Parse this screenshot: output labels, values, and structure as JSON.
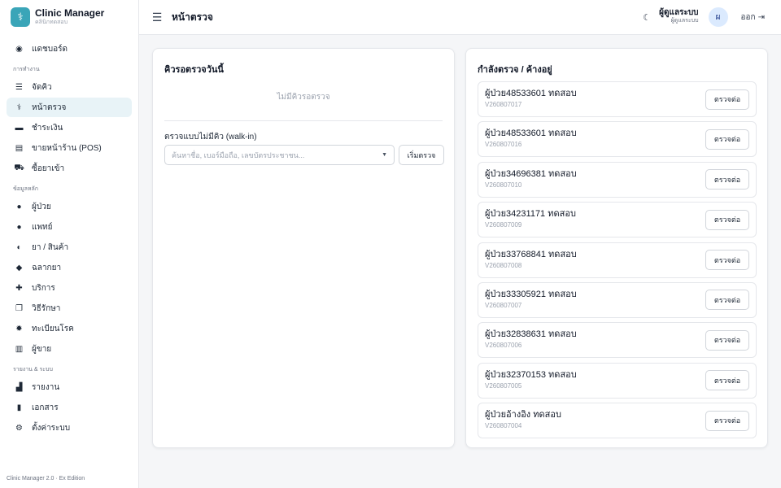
{
  "app": {
    "title": "Clinic Manager",
    "subtitle": "คลินิกทดสอบ",
    "version": "Clinic Manager 2.0 · Ex Edition"
  },
  "sidebar": {
    "items_top": [
      {
        "label": "แดชบอร์ด",
        "icon": "dashboard-icon"
      }
    ],
    "section_work": "การทำงาน",
    "items_work": [
      {
        "label": "จัดคิว",
        "icon": "queue-list-icon"
      },
      {
        "label": "หน้าตรวจ",
        "icon": "stethoscope-icon",
        "active": true
      },
      {
        "label": "ชำระเงิน",
        "icon": "credit-card-icon"
      },
      {
        "label": "ขายหน้าร้าน (POS)",
        "icon": "cash-register-icon"
      },
      {
        "label": "ซื้อยาเข้า",
        "icon": "truck-icon"
      }
    ],
    "section_master": "ข้อมูลหลัก",
    "items_master": [
      {
        "label": "ผู้ป่วย",
        "icon": "user-icon"
      },
      {
        "label": "แพทย์",
        "icon": "doctor-icon"
      },
      {
        "label": "ยา / สินค้า",
        "icon": "pills-icon"
      },
      {
        "label": "ฉลากยา",
        "icon": "tag-icon"
      },
      {
        "label": "บริการ",
        "icon": "medkit-icon"
      },
      {
        "label": "วิธีรักษา",
        "icon": "layers-icon"
      },
      {
        "label": "ทะเบียนโรค",
        "icon": "virus-icon"
      },
      {
        "label": "ผู้ขาย",
        "icon": "building-icon"
      }
    ],
    "section_report": "รายงาน & ระบบ",
    "items_report": [
      {
        "label": "รายงาน",
        "icon": "chart-icon"
      },
      {
        "label": "เอกสาร",
        "icon": "document-icon"
      },
      {
        "label": "ตั้งค่าระบบ",
        "icon": "gear-icon"
      }
    ]
  },
  "header": {
    "title": "หน้าตรวจ",
    "user_name": "ผู้ดูแลระบบ",
    "user_role": "ผู้ดูแลระบบ",
    "avatar_letter": "ผ",
    "logout_label": "ออก"
  },
  "left_card": {
    "title": "คิวรอตรวจวันนี้",
    "empty_text": "ไม่มีคิวรอตรวจ",
    "walkin_label": "ตรวจแบบไม่มีคิว (walk-in)",
    "search_placeholder": "ค้นหาชื่อ, เบอร์มือถือ, เลขบัตรประชาชน...",
    "start_button": "เริ่มตรวจ"
  },
  "right_card": {
    "title": "กำลังตรวจ / ค้างอยู่",
    "continue_label": "ตรวจต่อ",
    "rows": [
      {
        "name": "ผู้ป่วย48533601 ทดสอบ",
        "visit": "V260807017"
      },
      {
        "name": "ผู้ป่วย48533601 ทดสอบ",
        "visit": "V260807016"
      },
      {
        "name": "ผู้ป่วย34696381 ทดสอบ",
        "visit": "V260807010"
      },
      {
        "name": "ผู้ป่วย34231171 ทดสอบ",
        "visit": "V260807009"
      },
      {
        "name": "ผู้ป่วย33768841 ทดสอบ",
        "visit": "V260807008"
      },
      {
        "name": "ผู้ป่วย33305921 ทดสอบ",
        "visit": "V260807007"
      },
      {
        "name": "ผู้ป่วย32838631 ทดสอบ",
        "visit": "V260807006"
      },
      {
        "name": "ผู้ป่วย32370153 ทดสอบ",
        "visit": "V260807005"
      },
      {
        "name": "ผู้ป่วยอ้างอิง ทดสอบ",
        "visit": "V260807004"
      }
    ]
  },
  "colors": {
    "brand": "#3aa5b8",
    "active_bg": "#e8f3f7",
    "avatar_bg": "#dbeafe"
  }
}
